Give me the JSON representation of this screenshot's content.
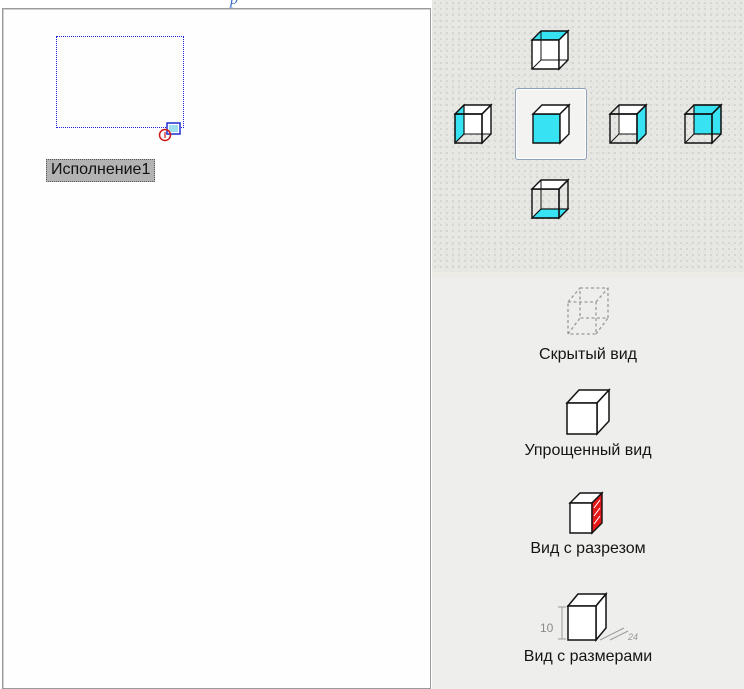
{
  "workspace": {
    "variant_label": "Исполнение1"
  },
  "orientation_panel": {
    "views": [
      {
        "id": "top",
        "icon": "cube-top-face-icon"
      },
      {
        "id": "left",
        "icon": "cube-left-face-icon"
      },
      {
        "id": "front",
        "icon": "cube-front-face-icon",
        "selected": true
      },
      {
        "id": "right",
        "icon": "cube-right-face-icon"
      },
      {
        "id": "back",
        "icon": "cube-back-face-icon"
      },
      {
        "id": "bottom",
        "icon": "cube-bottom-face-icon"
      }
    ],
    "accent_color": "#00e0f0"
  },
  "display_modes": [
    {
      "label": "Скрытый вид",
      "icon": "hidden-view-icon",
      "enabled": false
    },
    {
      "label": "Упрощенный вид",
      "icon": "simplified-view-icon",
      "enabled": true
    },
    {
      "label": "Вид с разрезом",
      "icon": "section-view-icon",
      "enabled": true
    },
    {
      "label": "Вид с размерами",
      "icon": "dimensions-view-icon",
      "enabled": true,
      "dimension_value": "10"
    }
  ]
}
